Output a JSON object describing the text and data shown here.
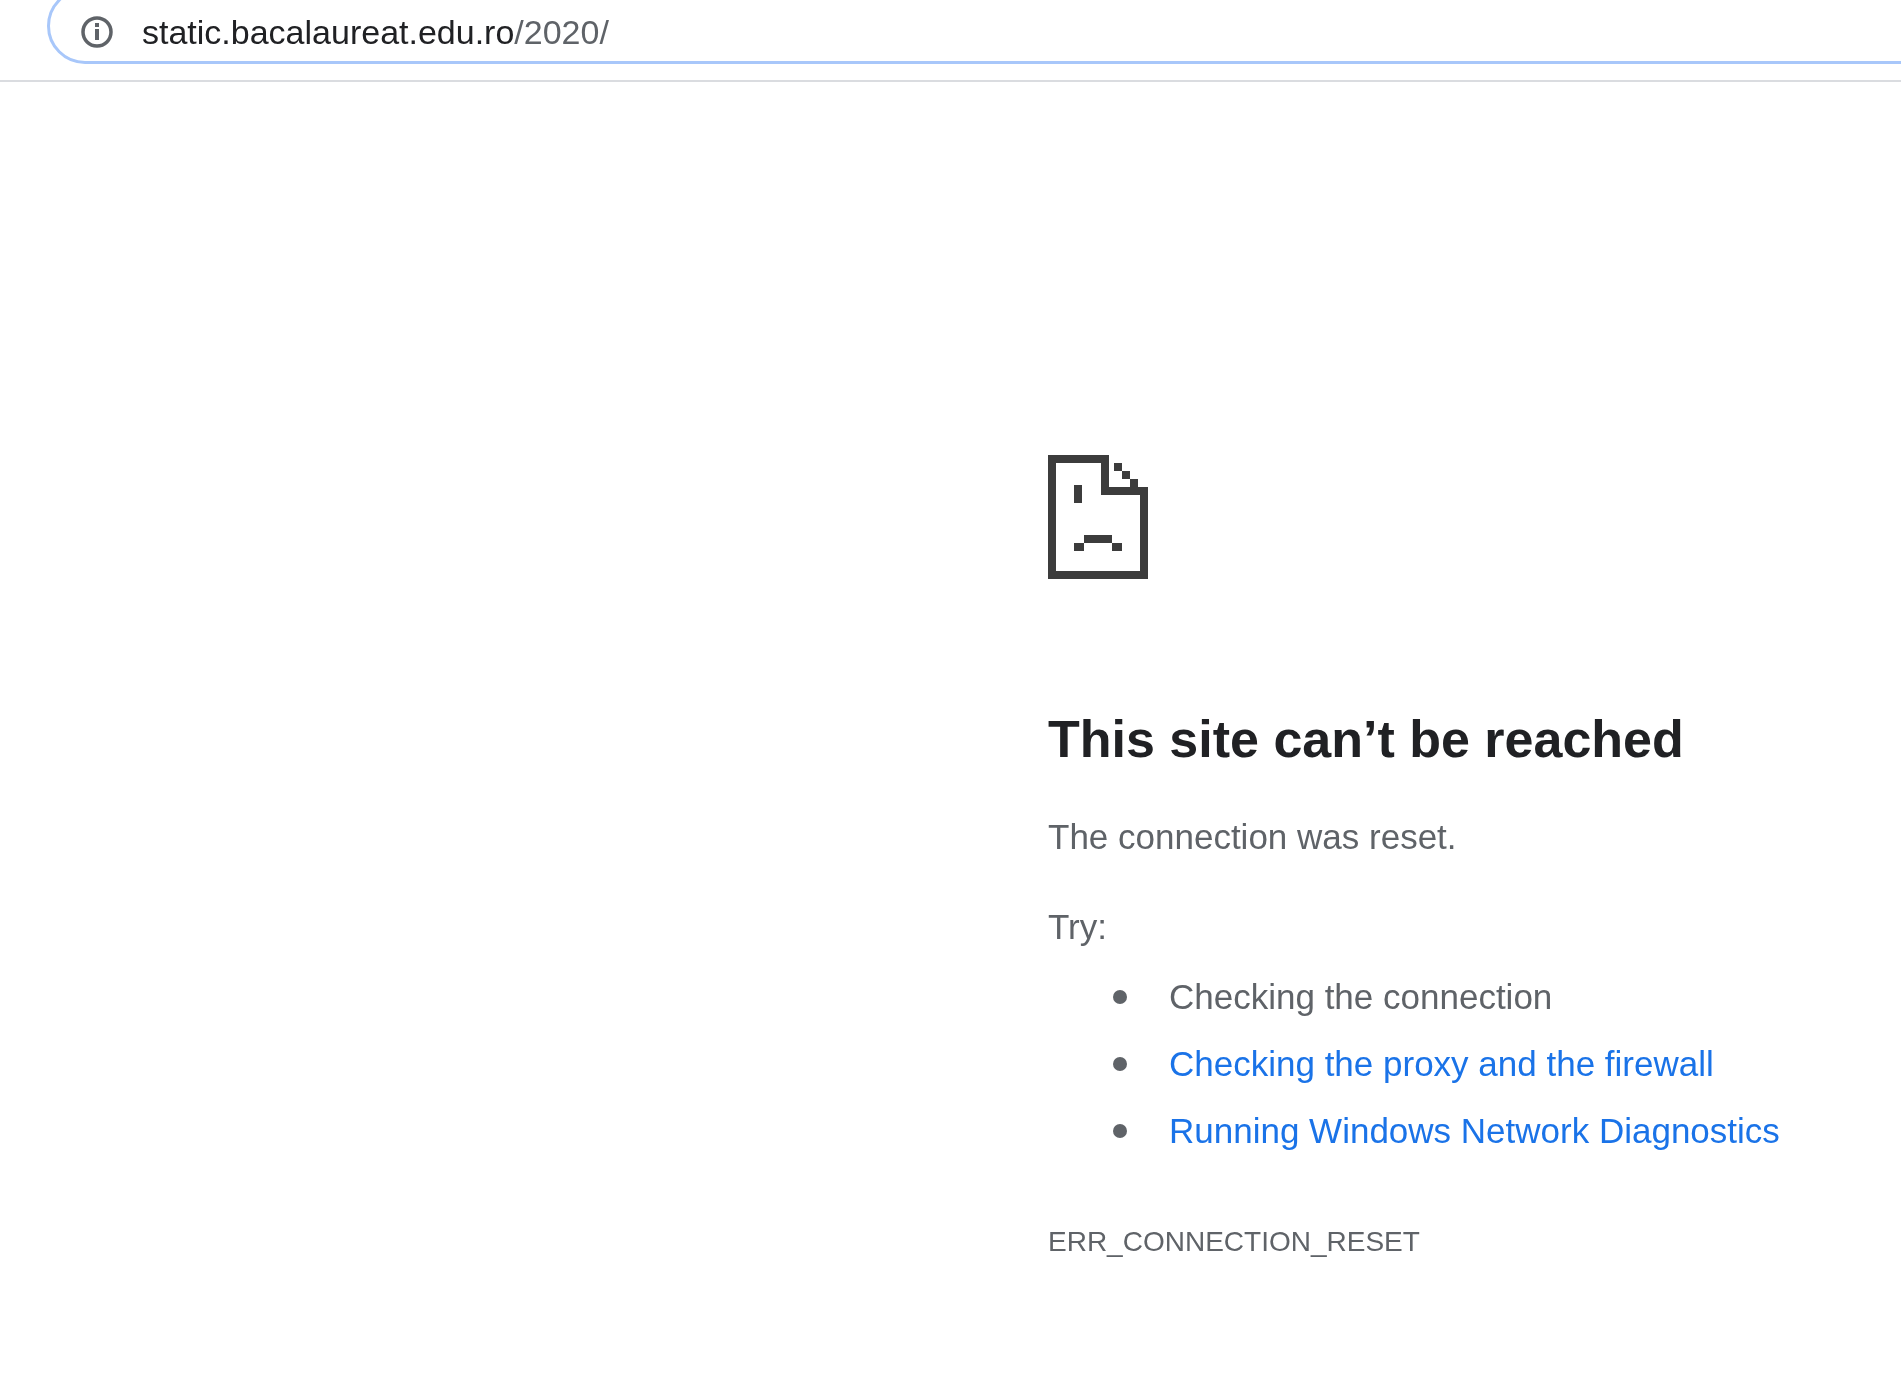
{
  "address_bar": {
    "host": "static.bacalaureat.edu.ro",
    "path": "/2020/"
  },
  "error": {
    "title": "This site can’t be reached",
    "message": "The connection was reset.",
    "try_label": "Try:",
    "suggestions": [
      {
        "text": "Checking the connection",
        "kind": "text"
      },
      {
        "text": "Checking the proxy and the firewall",
        "kind": "link"
      },
      {
        "text": "Running Windows Network Diagnostics",
        "kind": "link"
      }
    ],
    "code": "ERR_CONNECTION_RESET"
  }
}
